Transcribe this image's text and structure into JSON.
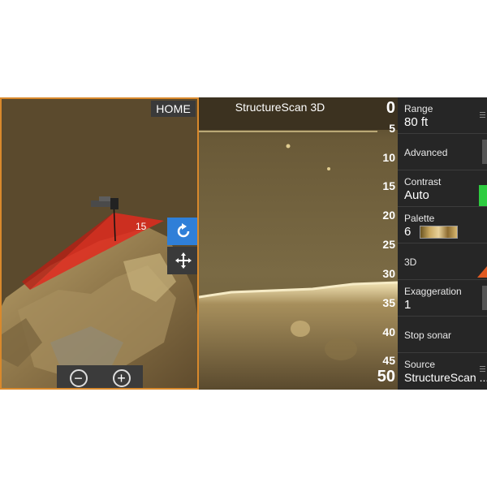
{
  "pane3d": {
    "home_label": "HOME",
    "depth_marker": "15",
    "rotate_icon": "rotate-icon",
    "pan_icon": "pan-arrows-icon",
    "zoom_out": "−",
    "zoom_in": "+"
  },
  "sonar": {
    "title": "StructureScan 3D",
    "depth_labels": [
      "0",
      "5",
      "10",
      "15",
      "20",
      "25",
      "30",
      "35",
      "40",
      "45",
      "50"
    ]
  },
  "menu": {
    "items": [
      {
        "label": "Range",
        "value": "80 ft"
      },
      {
        "label": "Advanced"
      },
      {
        "label": "Contrast",
        "value": "Auto"
      },
      {
        "label": "Palette",
        "value": "6"
      },
      {
        "label": "3D"
      },
      {
        "label": "Exaggeration",
        "value": "1"
      },
      {
        "label": "Stop sonar"
      },
      {
        "label": "Source",
        "value": "StructureScan ..."
      }
    ]
  },
  "colors": {
    "accent_orange": "#d9892c",
    "rotate_blue": "#2f7fd8",
    "contrast_green": "#2ecc40",
    "sonar_bottom": "#e8d6a0"
  }
}
